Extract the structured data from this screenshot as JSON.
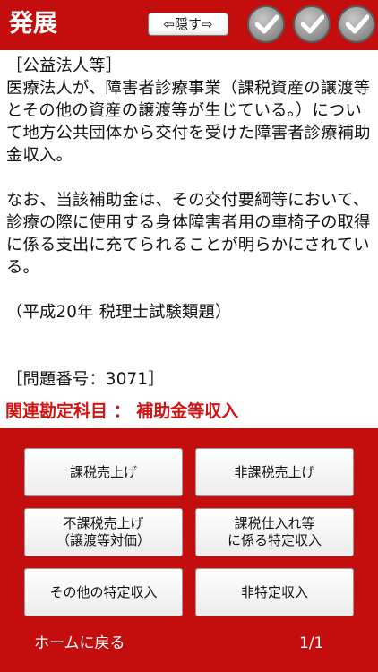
{
  "header": {
    "title": "発展",
    "hide_button": "⇦隠す⇨",
    "check_icons": [
      "checkmark-icon",
      "checkmark-icon",
      "checkmark-icon"
    ]
  },
  "question": {
    "category": "［公益法人等］",
    "paragraph1": "医療法人が、障害者診療事業（課税資産の譲渡等とその他の資産の譲渡等が生じている。）について地方公共団体から交付を受けた障害者診療補助金収入。",
    "paragraph2": "なお、当該補助金は、その交付要綱等において、診療の際に使用する身体障害者用の車椅子の取得に係る支出に充てられることが明らかにされている。",
    "source": "（平成20年 税理士試験類題）",
    "number": "［問題番号：3071］"
  },
  "related": "関連勘定科目 ： 補助金等収入",
  "options": [
    "課税売上げ",
    "非課税売上げ",
    "不課税売上げ\n（譲渡等対価）",
    "課税仕入れ等\nに係る特定収入",
    "その他の特定収入",
    "非特定収入"
  ],
  "footer": {
    "home": "ホームに戻る",
    "page": "1/1"
  },
  "colors": {
    "brand_red": "#c40d0d",
    "related_text": "#d11414"
  }
}
